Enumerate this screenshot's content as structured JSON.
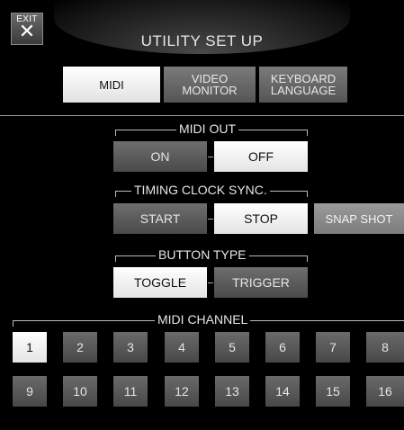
{
  "header": {
    "exit_label": "EXIT",
    "exit_glyph": "✕",
    "title": "UTILITY SET UP"
  },
  "tabs": [
    {
      "label": "MIDI",
      "active": true
    },
    {
      "label": "VIDEO\nMONITOR",
      "active": false
    },
    {
      "label": "KEYBOARD\nLANGUAGE",
      "active": false
    }
  ],
  "midi_out": {
    "label": "MIDI OUT",
    "on_label": "ON",
    "off_label": "OFF",
    "selected": "OFF"
  },
  "timing_clock_sync": {
    "label": "TIMING CLOCK SYNC.",
    "start_label": "START",
    "stop_label": "STOP",
    "snapshot_label": "SNAP SHOT",
    "selected": "STOP"
  },
  "button_type": {
    "label": "BUTTON TYPE",
    "toggle_label": "TOGGLE",
    "trigger_label": "TRIGGER",
    "selected": "TOGGLE"
  },
  "midi_channel": {
    "label": "MIDI CHANNEL",
    "selected": "1",
    "row1": [
      "1",
      "2",
      "3",
      "4",
      "5",
      "6",
      "7",
      "8"
    ],
    "row2": [
      "9",
      "10",
      "11",
      "12",
      "13",
      "14",
      "15",
      "16"
    ]
  },
  "colors": {
    "background": "#000000",
    "active_button": "#f2f2f2",
    "inactive_button": "#5a5a5a"
  }
}
